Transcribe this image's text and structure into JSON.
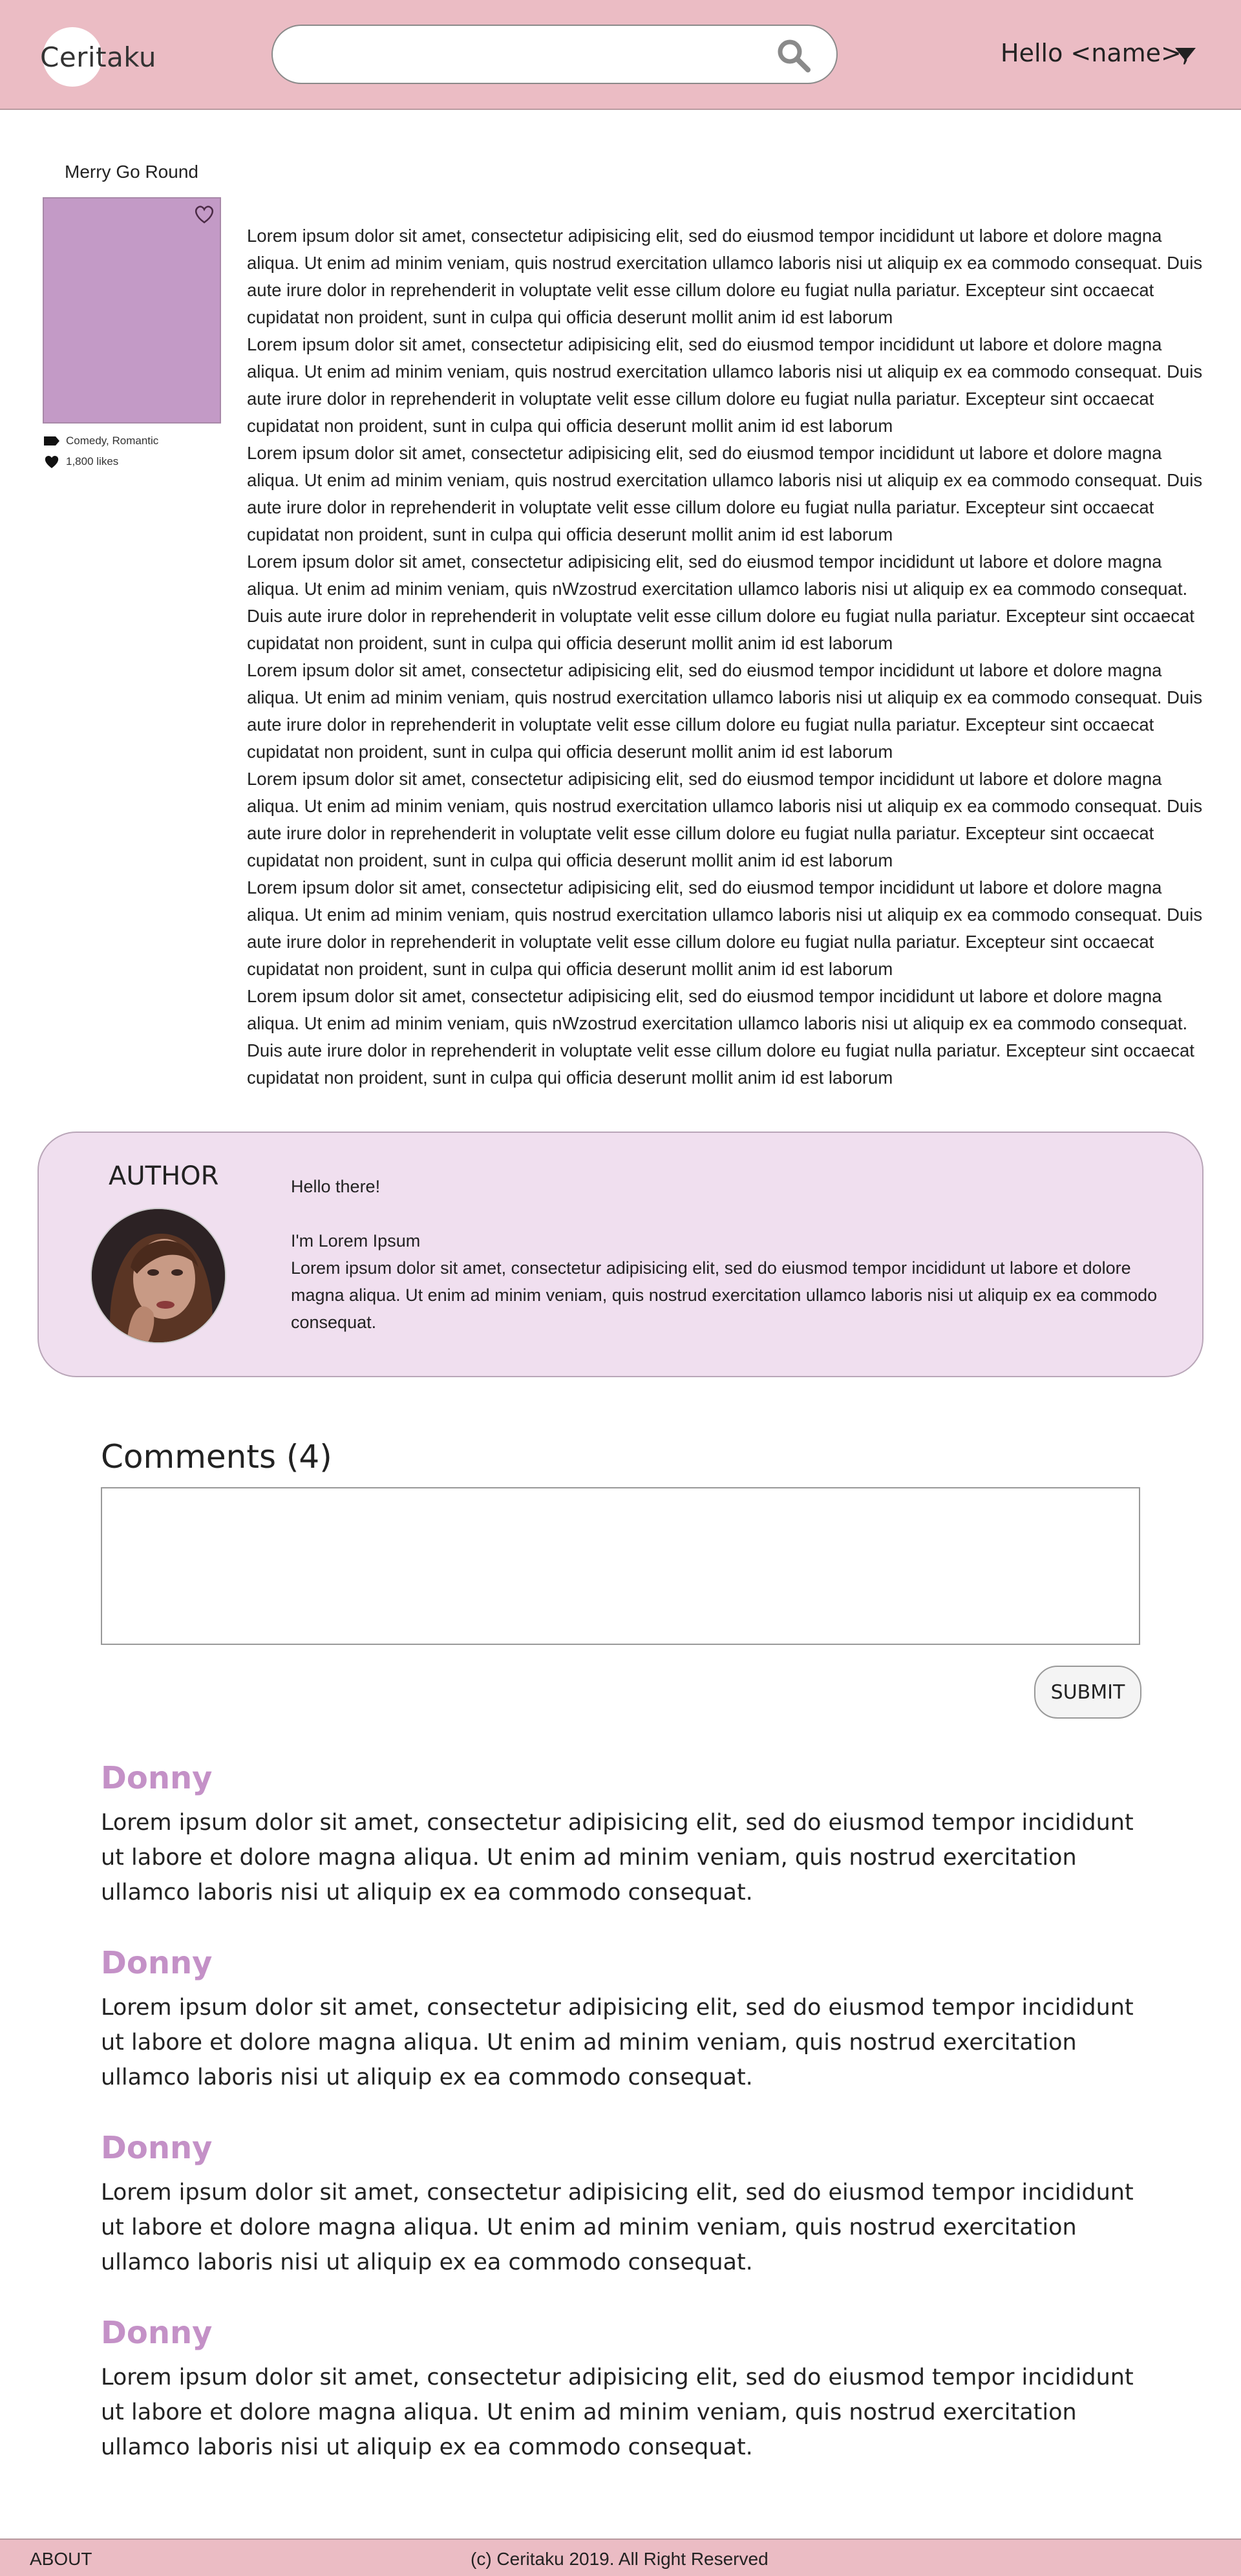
{
  "header": {
    "logo": "Ceritaku",
    "search_placeholder": "",
    "greeting": "Hello <name>,"
  },
  "book": {
    "title": "Merry Go Round",
    "genres": "Comedy, Romantic",
    "likes": "1,800 likes",
    "story": [
      "Lorem ipsum dolor sit amet, consectetur adipisicing elit, sed do eiusmod tempor incididunt ut labore et dolore magna aliqua. Ut enim ad minim veniam, quis nostrud exercitation ullamco laboris nisi ut aliquip ex ea commodo consequat. Duis aute irure dolor in reprehenderit in voluptate velit esse cillum dolore eu fugiat nulla pariatur. Excepteur sint occaecat cupidatat non proident, sunt in culpa qui officia deserunt mollit anim id est laborum",
      "Lorem ipsum dolor sit amet, consectetur adipisicing elit, sed do eiusmod tempor incididunt ut labore et dolore magna aliqua. Ut enim ad minim veniam, quis nostrud exercitation ullamco laboris nisi ut aliquip ex ea commodo consequat. Duis aute irure dolor in reprehenderit in voluptate velit esse cillum dolore eu fugiat nulla pariatur. Excepteur sint occaecat cupidatat non proident, sunt in culpa qui officia deserunt mollit anim id est laborum",
      "Lorem ipsum dolor sit amet, consectetur adipisicing elit, sed do eiusmod tempor incididunt ut labore et dolore magna aliqua. Ut enim ad minim veniam, quis nostrud exercitation ullamco laboris nisi ut aliquip ex ea commodo consequat. Duis aute irure dolor in reprehenderit in voluptate velit esse cillum dolore eu fugiat nulla pariatur. Excepteur sint occaecat cupidatat non proident, sunt in culpa qui officia deserunt mollit anim id est laborum",
      "Lorem ipsum dolor sit amet, consectetur adipisicing elit, sed do eiusmod tempor incididunt ut labore et dolore magna aliqua. Ut enim ad minim veniam, quis nWzostrud exercitation ullamco laboris nisi ut aliquip ex ea commodo consequat. Duis aute irure dolor in reprehenderit in voluptate velit esse cillum dolore eu fugiat nulla pariatur. Excepteur sint occaecat cupidatat non proident, sunt in culpa qui officia deserunt mollit anim id est laborum",
      "Lorem ipsum dolor sit amet, consectetur adipisicing elit, sed do eiusmod tempor incididunt ut labore et dolore magna aliqua. Ut enim ad minim veniam, quis nostrud exercitation ullamco laboris nisi ut aliquip ex ea commodo consequat. Duis aute irure dolor in reprehenderit in voluptate velit esse cillum dolore eu fugiat nulla pariatur. Excepteur sint occaecat cupidatat non proident, sunt in culpa qui officia deserunt mollit anim id est laborum",
      "Lorem ipsum dolor sit amet, consectetur adipisicing elit, sed do eiusmod tempor incididunt ut labore et dolore magna aliqua. Ut enim ad minim veniam, quis nostrud exercitation ullamco laboris nisi ut aliquip ex ea commodo consequat. Duis aute irure dolor in reprehenderit in voluptate velit esse cillum dolore eu fugiat nulla pariatur. Excepteur sint occaecat cupidatat non proident, sunt in culpa qui officia deserunt mollit anim id est laborum",
      "Lorem ipsum dolor sit amet, consectetur adipisicing elit, sed do eiusmod tempor incididunt ut labore et dolore magna aliqua. Ut enim ad minim veniam, quis nostrud exercitation ullamco laboris nisi ut aliquip ex ea commodo consequat. Duis aute irure dolor in reprehenderit in voluptate velit esse cillum dolore eu fugiat nulla pariatur. Excepteur sint occaecat cupidatat non proident, sunt in culpa qui officia deserunt mollit anim id est laborum",
      "Lorem ipsum dolor sit amet, consectetur adipisicing elit, sed do eiusmod tempor incididunt ut labore et dolore magna aliqua. Ut enim ad minim veniam, quis nWzostrud exercitation ullamco laboris nisi ut aliquip ex ea commodo consequat. Duis aute irure dolor in reprehenderit in voluptate velit esse cillum dolore eu fugiat nulla pariatur. Excepteur sint occaecat cupidatat non proident, sunt in culpa qui officia deserunt mollit anim id est laborum"
    ]
  },
  "author": {
    "heading": "AUTHOR",
    "greeting": "Hello there!",
    "name_line": "I'm Lorem Ipsum",
    "bio": "Lorem ipsum dolor sit amet, consectetur adipisicing elit, sed do eiusmod tempor incididunt ut labore et dolore magna aliqua. Ut enim ad minim veniam, quis nostrud exercitation ullamco laboris nisi ut aliquip ex ea commodo consequat."
  },
  "comments": {
    "title": "Comments (4)",
    "input_value": "",
    "submit_label": "SUBMIT",
    "items": [
      {
        "author": "Donny",
        "text": "Lorem ipsum dolor sit amet, consectetur adipisicing elit, sed do eiusmod tempor incididunt ut labore et dolore magna aliqua. Ut enim ad minim veniam, quis nostrud exercitation ullamco laboris nisi ut aliquip ex ea commodo consequat."
      },
      {
        "author": "Donny",
        "text": "Lorem ipsum dolor sit amet, consectetur adipisicing elit, sed do eiusmod tempor incididunt ut labore et dolore magna aliqua. Ut enim ad minim veniam, quis nostrud exercitation ullamco laboris nisi ut aliquip ex ea commodo consequat."
      },
      {
        "author": "Donny",
        "text": "Lorem ipsum dolor sit amet, consectetur adipisicing elit, sed do eiusmod tempor incididunt ut labore et dolore magna aliqua. Ut enim ad minim veniam, quis nostrud exercitation ullamco laboris nisi ut aliquip ex ea commodo consequat."
      },
      {
        "author": "Donny",
        "text": "Lorem ipsum dolor sit amet, consectetur adipisicing elit, sed do eiusmod tempor incididunt ut labore et dolore magna aliqua. Ut enim ad minim veniam, quis nostrud exercitation ullamco laboris nisi ut aliquip ex ea commodo consequat."
      }
    ]
  },
  "footer": {
    "about": "ABOUT",
    "copyright": "(c) Ceritaku 2019. All Right Reserved"
  },
  "icons": {
    "search": "search-icon",
    "dropdown": "caret-down-icon",
    "favorite": "heart-outline-icon",
    "genre": "tag-icon",
    "likes": "heart-icon"
  },
  "colors": {
    "header_bg": "#ebbcc4",
    "cover": "#c39ac6",
    "author_card": "#f0dfef",
    "comment_author": "#c491c7"
  }
}
